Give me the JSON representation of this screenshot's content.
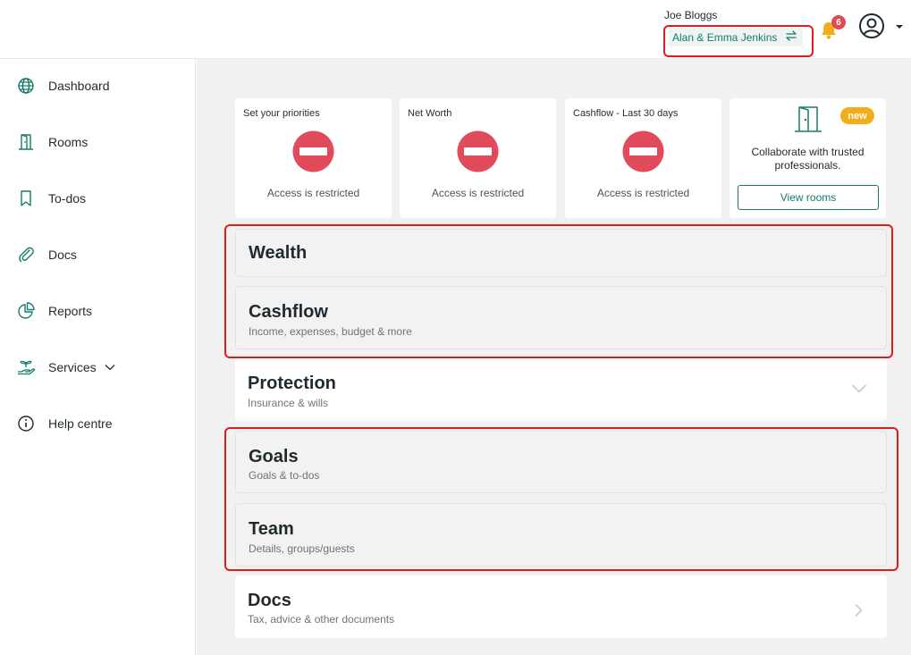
{
  "header": {
    "user_name": "Joe Bloggs",
    "client_name": "Alan & Emma Jenkins",
    "client_switch_icon": "swap-arrows-icon",
    "notification_icon": "bell-icon",
    "notification_count": "6",
    "account_icon": "user-circle-icon"
  },
  "sidebar": {
    "items": [
      {
        "label": "Dashboard",
        "icon": "globe-icon"
      },
      {
        "label": "Rooms",
        "icon": "door-icon"
      },
      {
        "label": "To-dos",
        "icon": "bookmark-icon"
      },
      {
        "label": "Docs",
        "icon": "paperclip-icon"
      },
      {
        "label": "Reports",
        "icon": "pie-chart-icon"
      },
      {
        "label": "Services",
        "icon": "hand-plant-icon"
      },
      {
        "label": "Help centre",
        "icon": "info-icon"
      }
    ]
  },
  "cards": [
    {
      "title": "Set your priorities",
      "status": "Access is restricted"
    },
    {
      "title": "Net Worth",
      "status": "Access is restricted"
    },
    {
      "title": "Cashflow - Last 30 days",
      "status": "Access is restricted"
    }
  ],
  "collab_card": {
    "badge": "new",
    "message": "Collaborate with trusted professionals.",
    "button_label": "View rooms"
  },
  "sections": [
    {
      "title": "Wealth",
      "subtitle": ""
    },
    {
      "title": "Cashflow",
      "subtitle": "Income, expenses, budget & more"
    },
    {
      "title": "Protection",
      "subtitle": "Insurance & wills"
    },
    {
      "title": "Goals",
      "subtitle": "Goals & to-dos"
    },
    {
      "title": "Team",
      "subtitle": "Details, groups/guests"
    },
    {
      "title": "Docs",
      "subtitle": "Tax, advice & other documents"
    }
  ],
  "colors": {
    "accent": "#177a6c",
    "restricted": "#e04a5a",
    "badge": "#e04a52",
    "new_pill": "#f2ad1c",
    "highlight": "#e11b1b"
  }
}
